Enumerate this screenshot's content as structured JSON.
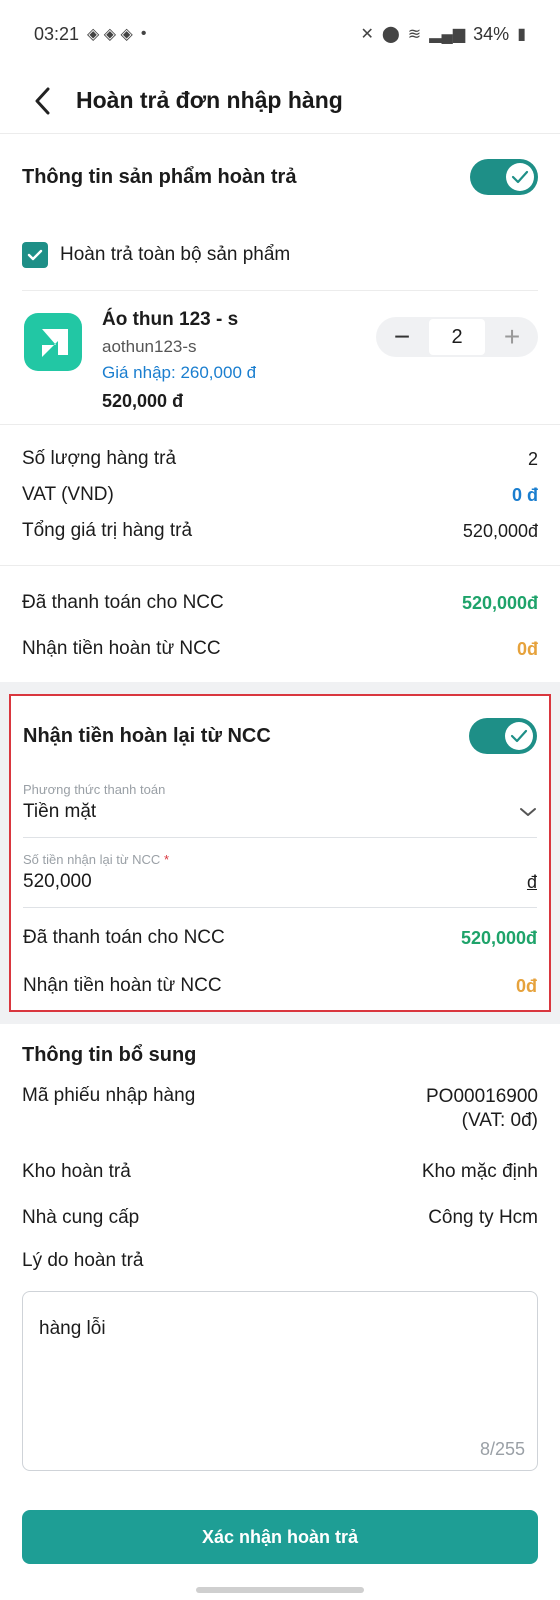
{
  "status_bar": {
    "time": "03:21",
    "battery": "34%"
  },
  "header": {
    "title": "Hoàn trả đơn nhập hàng"
  },
  "return_info": {
    "title": "Thông tin sản phẩm hoàn trả",
    "toggle_on": true,
    "return_all_label": "Hoàn trả toàn bộ sản phẩm",
    "return_all_checked": true
  },
  "product": {
    "name": "Áo thun 123 - s",
    "sku": "aothun123-s",
    "price_in": "Giá nhập: 260,000 đ",
    "total": "520,000 đ",
    "quantity": "2"
  },
  "summary": {
    "qty_label": "Số lượng hàng trả",
    "qty_value": "2",
    "vat_label": "VAT (VND)",
    "vat_value": "0 đ",
    "total_label": "Tổng giá trị hàng trả",
    "total_value": "520,000đ"
  },
  "payment": {
    "paid_label": "Đã thanh toán cho NCC",
    "paid_value": "520,000đ",
    "refund_label": "Nhận tiền hoàn từ NCC",
    "refund_value": "0đ"
  },
  "refund_section": {
    "title": "Nhận tiền hoàn lại từ NCC",
    "toggle_on": true,
    "method_label": "Phương thức thanh toán",
    "method_value": "Tiền mặt",
    "amount_label": "Số tiền nhận lại từ NCC",
    "amount_required": "*",
    "amount_value": "520,000",
    "amount_unit": "đ",
    "paid_label": "Đã thanh toán cho NCC",
    "paid_value": "520,000đ",
    "refund_label": "Nhận tiền hoàn từ NCC",
    "refund_value": "0đ"
  },
  "additional": {
    "title": "Thông tin bổ sung",
    "receipt_label": "Mã phiếu nhập hàng",
    "receipt_value": "PO00016900",
    "receipt_vat": "(VAT: 0đ)",
    "warehouse_label": "Kho hoàn trả",
    "warehouse_value": "Kho mặc định",
    "supplier_label": "Nhà cung cấp",
    "supplier_value": "Công ty Hcm",
    "reason_label": "Lý do hoàn trả",
    "reason_value": "hàng lỗi",
    "reason_counter": "8/255"
  },
  "confirm_button": "Xác nhận hoàn trả",
  "colors": {
    "primary": "#1e8f87",
    "button": "#1e9e95",
    "highlight_border": "#d9363e",
    "green_value": "#1ea36a",
    "orange_value": "#e6a23c",
    "blue_value": "#1a7ecf"
  }
}
